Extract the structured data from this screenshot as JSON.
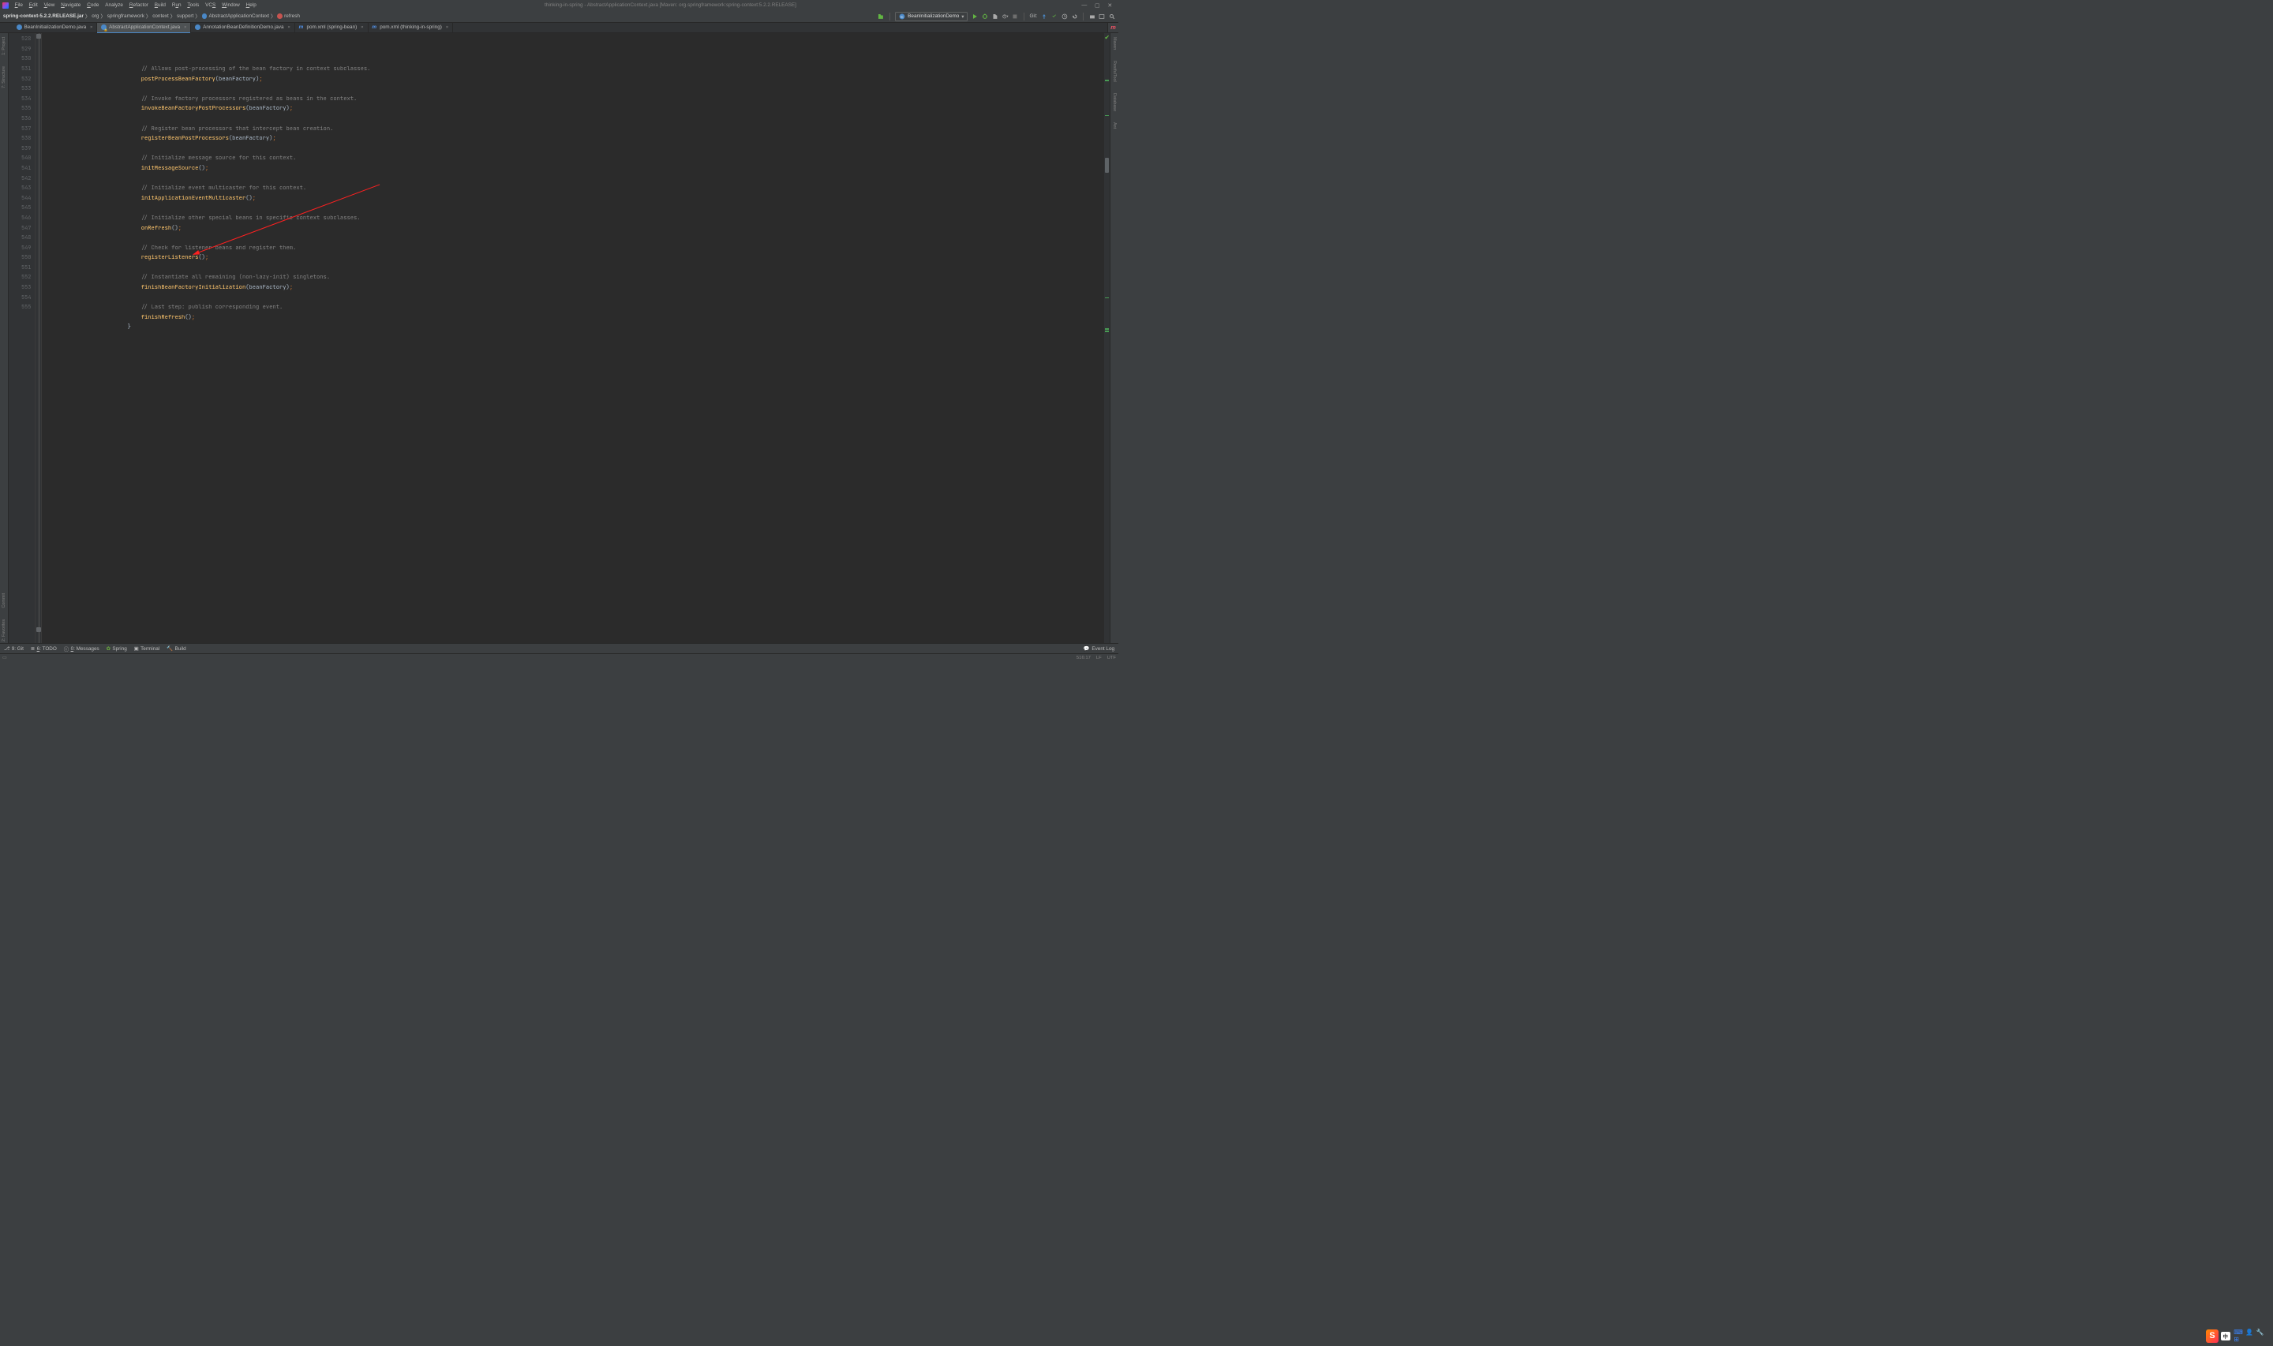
{
  "window": {
    "title": "thinking-in-spring - AbstractApplicationContext.java [Maven: org.springframework:spring-context:5.2.2.RELEASE]"
  },
  "menu": {
    "file": "File",
    "edit": "Edit",
    "view": "View",
    "navigate": "Navigate",
    "code": "Code",
    "analyze": "Analyze",
    "refactor": "Refactor",
    "build": "Build",
    "run": "Run",
    "tools": "Tools",
    "vcs": "VCS",
    "window": "Window",
    "help": "Help"
  },
  "breadcrumbs": [
    {
      "label": "spring-context-5.2.2.RELEASE.jar",
      "strong": true
    },
    {
      "label": "org"
    },
    {
      "label": "springframework"
    },
    {
      "label": "context"
    },
    {
      "label": "support"
    },
    {
      "label": "AbstractApplicationContext",
      "icon": "class"
    },
    {
      "label": "refresh",
      "icon": "method"
    }
  ],
  "run_config": "BeanInitializationDemo",
  "git_label": "Git:",
  "tabs": [
    {
      "label": "BeanInitializationDemo.java",
      "kind": "java",
      "active": false
    },
    {
      "label": "AbstractApplicationContext.java",
      "kind": "java-lock",
      "active": true
    },
    {
      "label": "AnnotationBeanDefinitionDemo.java",
      "kind": "java",
      "active": false
    },
    {
      "label": "pom.xml (spring-bean)",
      "kind": "xml",
      "active": false
    },
    {
      "label": "pom.xml (thinking-in-spring)",
      "kind": "xml",
      "active": false
    }
  ],
  "left_tools": [
    {
      "label": "1: Project",
      "key": "project"
    },
    {
      "label": "7: Structure",
      "key": "structure"
    },
    {
      "label": "Commit",
      "key": "commit"
    },
    {
      "label": "2: Favorites",
      "key": "favorites"
    }
  ],
  "right_tools": [
    {
      "label": "Maven",
      "key": "maven"
    },
    {
      "label": "RestfulTool",
      "key": "restfultool"
    },
    {
      "label": "Database",
      "key": "database"
    },
    {
      "label": "Ant",
      "key": "ant"
    }
  ],
  "gutter_start": 528,
  "gutter_end": 555,
  "code_lines": [
    {
      "indent": 28,
      "tokens": [
        {
          "t": "// Allows post-processing of the bean factory in context subclasses.",
          "c": "cmt"
        }
      ]
    },
    {
      "indent": 28,
      "tokens": [
        {
          "t": "postProcessBeanFactory",
          "c": "mth"
        },
        {
          "t": "(beanFactory)",
          "c": "pnc"
        },
        {
          "t": ";",
          "c": "sem"
        }
      ]
    },
    {
      "indent": 0,
      "tokens": []
    },
    {
      "indent": 28,
      "tokens": [
        {
          "t": "// Invoke factory processors registered as beans in the context.",
          "c": "cmt"
        }
      ]
    },
    {
      "indent": 28,
      "tokens": [
        {
          "t": "invokeBeanFactoryPostProcessors",
          "c": "mth"
        },
        {
          "t": "(beanFactory)",
          "c": "pnc"
        },
        {
          "t": ";",
          "c": "sem"
        }
      ]
    },
    {
      "indent": 0,
      "tokens": []
    },
    {
      "indent": 28,
      "tokens": [
        {
          "t": "// Register bean processors that intercept bean creation.",
          "c": "cmt"
        }
      ]
    },
    {
      "indent": 28,
      "tokens": [
        {
          "t": "registerBeanPostProcessors",
          "c": "mth"
        },
        {
          "t": "(beanFactory)",
          "c": "pnc"
        },
        {
          "t": ";",
          "c": "sem"
        }
      ]
    },
    {
      "indent": 0,
      "tokens": []
    },
    {
      "indent": 28,
      "tokens": [
        {
          "t": "// Initialize message source for this context.",
          "c": "cmt"
        }
      ]
    },
    {
      "indent": 28,
      "tokens": [
        {
          "t": "initMessageSource",
          "c": "mth"
        },
        {
          "t": "()",
          "c": "pnc"
        },
        {
          "t": ";",
          "c": "sem"
        }
      ]
    },
    {
      "indent": 0,
      "tokens": []
    },
    {
      "indent": 28,
      "tokens": [
        {
          "t": "// Initialize event multicaster for this context.",
          "c": "cmt"
        }
      ]
    },
    {
      "indent": 28,
      "tokens": [
        {
          "t": "initApplicationEventMulticaster",
          "c": "mth"
        },
        {
          "t": "()",
          "c": "pnc"
        },
        {
          "t": ";",
          "c": "sem"
        }
      ]
    },
    {
      "indent": 0,
      "tokens": []
    },
    {
      "indent": 28,
      "tokens": [
        {
          "t": "// Initialize other special beans in specific context subclasses.",
          "c": "cmt"
        }
      ]
    },
    {
      "indent": 28,
      "tokens": [
        {
          "t": "onRefresh",
          "c": "mth"
        },
        {
          "t": "()",
          "c": "pnc"
        },
        {
          "t": ";",
          "c": "sem"
        }
      ]
    },
    {
      "indent": 0,
      "tokens": []
    },
    {
      "indent": 28,
      "tokens": [
        {
          "t": "// Check for listener beans and register them.",
          "c": "cmt"
        }
      ]
    },
    {
      "indent": 28,
      "tokens": [
        {
          "t": "registerListeners",
          "c": "mth"
        },
        {
          "t": "()",
          "c": "pnc"
        },
        {
          "t": ";",
          "c": "sem"
        }
      ]
    },
    {
      "indent": 0,
      "tokens": []
    },
    {
      "indent": 28,
      "tokens": [
        {
          "t": "// Instantiate all remaining (non-lazy-init) singletons.",
          "c": "cmt"
        }
      ]
    },
    {
      "indent": 28,
      "tokens": [
        {
          "t": "finishBeanFactoryInitialization",
          "c": "mth"
        },
        {
          "t": "(beanFactory)",
          "c": "pnc"
        },
        {
          "t": ";",
          "c": "sem"
        }
      ]
    },
    {
      "indent": 0,
      "tokens": []
    },
    {
      "indent": 28,
      "tokens": [
        {
          "t": "// Last step: publish corresponding event.",
          "c": "cmt"
        }
      ]
    },
    {
      "indent": 28,
      "tokens": [
        {
          "t": "finishRefresh",
          "c": "mth"
        },
        {
          "t": "()",
          "c": "pnc"
        },
        {
          "t": ";",
          "c": "sem"
        }
      ]
    },
    {
      "indent": 24,
      "tokens": [
        {
          "t": "}",
          "c": "pnc"
        }
      ]
    },
    {
      "indent": 0,
      "tokens": []
    }
  ],
  "bottom_tools": {
    "git": "9: Git",
    "todo": "6: TODO",
    "messages": "0: Messages",
    "spring": "Spring",
    "terminal": "Terminal",
    "build": "Build",
    "eventlog": "Event Log"
  },
  "status": {
    "pos": "516:17",
    "lf": "LF",
    "enc": "UTF"
  },
  "ime": {
    "logo": "S",
    "lang": "中"
  }
}
